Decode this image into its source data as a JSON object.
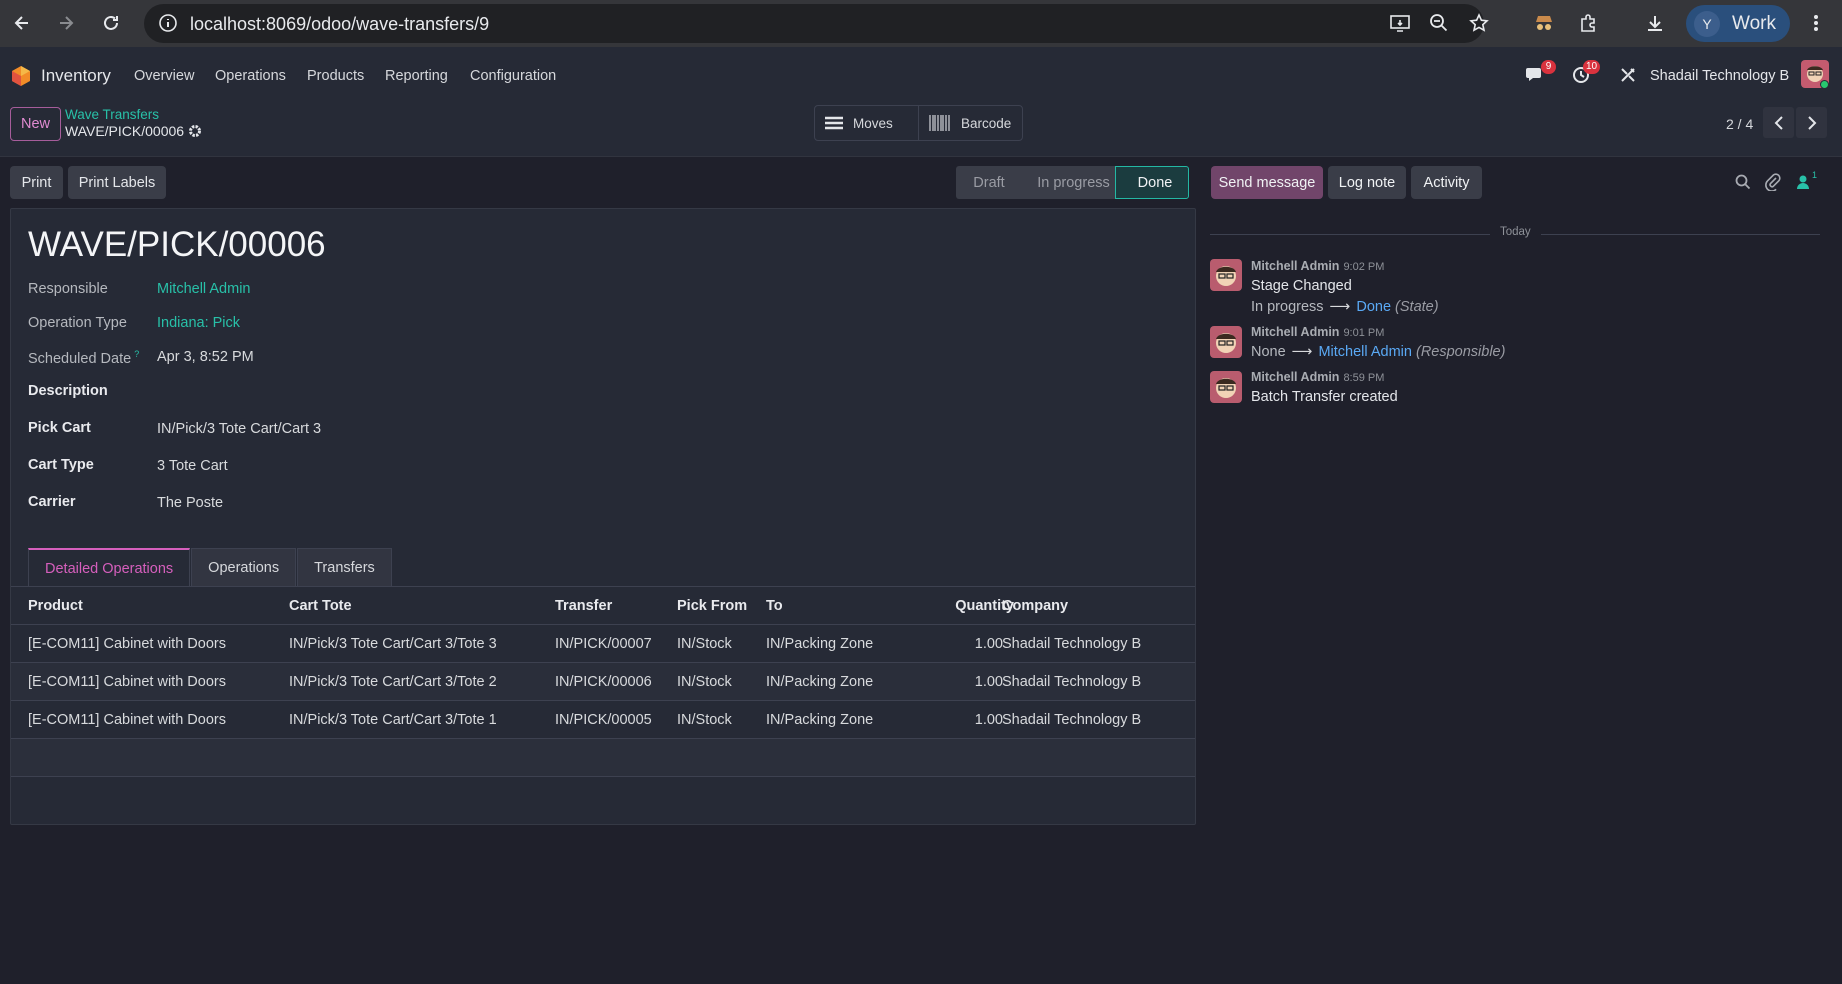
{
  "browser": {
    "url": "localhost:8069/odoo/wave-transfers/9",
    "profile_initial": "Y",
    "profile_label": "Work"
  },
  "nav": {
    "app_name": "Inventory",
    "menu": [
      "Overview",
      "Operations",
      "Products",
      "Reporting",
      "Configuration"
    ],
    "messages_count": "9",
    "activities_count": "10",
    "company": "Shadail Technology B"
  },
  "control": {
    "new_label": "New",
    "breadcrumb_parent": "Wave Transfers",
    "breadcrumb_current": "WAVE/PICK/00006",
    "moves_label": "Moves",
    "barcode_label": "Barcode",
    "pager": "2 / 4"
  },
  "actions": {
    "print": "Print",
    "print_labels": "Print Labels"
  },
  "statusbar": {
    "steps": [
      "Draft",
      "In progress",
      "Done"
    ],
    "current": "Done"
  },
  "chatter_actions": {
    "send_message": "Send message",
    "log_note": "Log note",
    "activity": "Activity",
    "followers_count": "1"
  },
  "form": {
    "title": "WAVE/PICK/00006",
    "fields": {
      "responsible_label": "Responsible",
      "responsible_value": "Mitchell Admin",
      "operation_type_label": "Operation Type",
      "operation_type_value": "Indiana: Pick",
      "scheduled_date_label": "Scheduled Date",
      "scheduled_date_help": "?",
      "scheduled_date_value": "Apr 3, 8:52 PM",
      "description_label": "Description",
      "pick_cart_label": "Pick Cart",
      "pick_cart_value": "IN/Pick/3 Tote Cart/Cart 3",
      "cart_type_label": "Cart Type",
      "cart_type_value": "3 Tote Cart",
      "carrier_label": "Carrier",
      "carrier_value": "The Poste"
    },
    "tabs": [
      "Detailed Operations",
      "Operations",
      "Transfers"
    ],
    "table": {
      "columns": [
        "Product",
        "Cart Tote",
        "Transfer",
        "Pick From",
        "To",
        "Quantity",
        "Company"
      ],
      "rows": [
        [
          "[E-COM11] Cabinet with Doors",
          "IN/Pick/3 Tote Cart/Cart 3/Tote 3",
          "IN/PICK/00007",
          "IN/Stock",
          "IN/Packing Zone",
          "1.00",
          "Shadail Technology B"
        ],
        [
          "[E-COM11] Cabinet with Doors",
          "IN/Pick/3 Tote Cart/Cart 3/Tote 2",
          "IN/PICK/00006",
          "IN/Stock",
          "IN/Packing Zone",
          "1.00",
          "Shadail Technology B"
        ],
        [
          "[E-COM11] Cabinet with Doors",
          "IN/Pick/3 Tote Cart/Cart 3/Tote 1",
          "IN/PICK/00005",
          "IN/Stock",
          "IN/Packing Zone",
          "1.00",
          "Shadail Technology B"
        ]
      ]
    }
  },
  "chatter": {
    "date_separator": "Today",
    "messages": [
      {
        "author": "Mitchell Admin",
        "time": "9:02 PM",
        "text": "Stage Changed",
        "old_value": "In progress",
        "new_value": "Done",
        "field": "(State)"
      },
      {
        "author": "Mitchell Admin",
        "time": "9:01 PM",
        "old_value": "None",
        "new_value": "Mitchell Admin",
        "field": "(Responsible)"
      },
      {
        "author": "Mitchell Admin",
        "time": "8:59 PM",
        "text": "Batch Transfer created"
      }
    ]
  }
}
